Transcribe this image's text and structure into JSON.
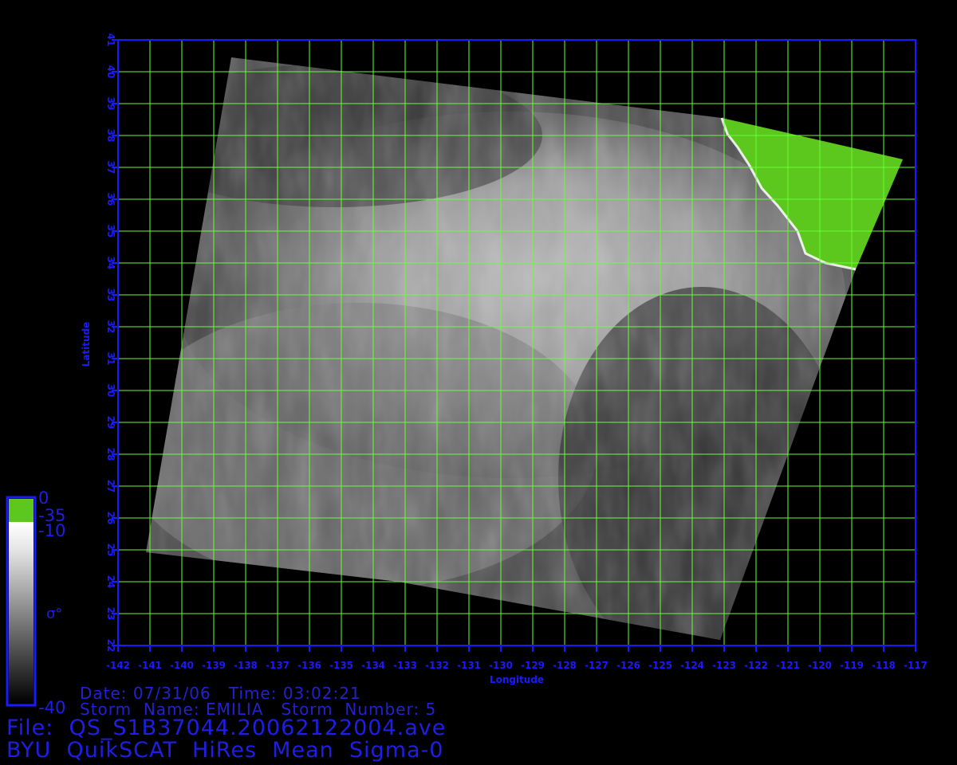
{
  "map": {
    "x_axis_label": "Longitude",
    "y_axis_label": "Latitude",
    "lon_ticks": [
      "-142",
      "-141",
      "-140",
      "-139",
      "-138",
      "-137",
      "-136",
      "-135",
      "-134",
      "-133",
      "-132",
      "-131",
      "-130",
      "-129",
      "-128",
      "-127",
      "-126",
      "-125",
      "-124",
      "-123",
      "-122",
      "-121",
      "-120",
      "-119",
      "-118",
      "-117"
    ],
    "lat_ticks": [
      "22",
      "23",
      "24",
      "25",
      "26",
      "27",
      "28",
      "29",
      "30",
      "31",
      "32",
      "33",
      "34",
      "35",
      "36",
      "37",
      "38",
      "39",
      "40",
      "41"
    ],
    "lon_range": [
      -142,
      -117
    ],
    "lat_range": [
      22,
      41
    ],
    "grid_color": "#66ff33",
    "axis_color": "#1a1aff",
    "land_color": "#5cc81e",
    "ocean_colormap": "grayscale"
  },
  "colorbar": {
    "top_label": "0",
    "green_label": "-35",
    "white_label": "-10",
    "bottom_label": "-40",
    "quantity_label": "σ°"
  },
  "info": {
    "date_line": "Date: 07/31/06   Time: 03:02:21",
    "storm_line": "Storm  Name: EMILIA   Storm  Number: 5",
    "file_line": "File:  QS_S1B37044.20062122004.ave",
    "product_line": "BYU  QuikSCAT  HiRes  Mean  Sigma-0"
  }
}
